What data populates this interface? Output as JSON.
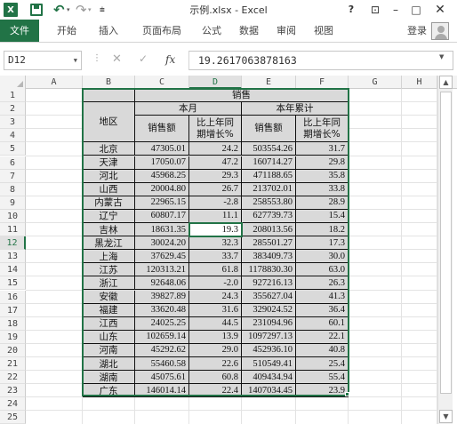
{
  "app": {
    "title": "示例.xlsx - Excel",
    "excel_logo": "X",
    "accent_color": "#217346",
    "icons": [
      "excel-logo-icon",
      "save-icon",
      "undo-icon",
      "redo-icon",
      "help-icon",
      "ribbon-options-icon",
      "minimize-icon",
      "maximize-icon",
      "close-icon",
      "avatar"
    ],
    "help": "?",
    "minimize": "–",
    "maximize": "□",
    "close": "✕"
  },
  "ribbon": {
    "tabs": [
      "文件",
      "开始",
      "插入",
      "页面布局",
      "公式",
      "数据",
      "审阅",
      "视图"
    ],
    "login": "登录"
  },
  "formula_bar": {
    "name_box": "D12",
    "fx": "fx",
    "formula": "19.2617063878163"
  },
  "grid": {
    "columns": [
      "A",
      "B",
      "C",
      "D",
      "E",
      "F",
      "G",
      "H"
    ],
    "selected_column": "D",
    "rows": [
      "1",
      "2",
      "3",
      "4",
      "5",
      "6",
      "7",
      "8",
      "9",
      "10",
      "11",
      "12",
      "13",
      "14",
      "15",
      "16",
      "17",
      "18",
      "19",
      "20",
      "21",
      "22",
      "23",
      "24",
      "25"
    ],
    "selected_row": "12",
    "active_cell": "D12"
  },
  "table": {
    "header_top": "销售",
    "header_region": "地区",
    "header_month": "本月",
    "header_ytd": "本年累计",
    "header_sales": "销售额",
    "header_yoy_line1": "比上年同",
    "header_yoy_line2": "期增长%",
    "header_sales2": "销售额",
    "header_yoy2_line1": "比上年同",
    "header_yoy2_line2": "期增长%",
    "rows": [
      {
        "region": "北京",
        "sales": "47305.01",
        "yoy": "24.2",
        "ytd_sales": "503554.26",
        "ytd_yoy": "31.7"
      },
      {
        "region": "天津",
        "sales": "17050.07",
        "yoy": "47.2",
        "ytd_sales": "160714.27",
        "ytd_yoy": "29.8"
      },
      {
        "region": "河北",
        "sales": "45968.25",
        "yoy": "29.3",
        "ytd_sales": "471188.65",
        "ytd_yoy": "35.8"
      },
      {
        "region": "山西",
        "sales": "20004.80",
        "yoy": "26.7",
        "ytd_sales": "213702.01",
        "ytd_yoy": "33.8"
      },
      {
        "region": "内蒙古",
        "sales": "22965.15",
        "yoy": "-2.8",
        "ytd_sales": "258553.80",
        "ytd_yoy": "28.9"
      },
      {
        "region": "辽宁",
        "sales": "60807.17",
        "yoy": "11.1",
        "ytd_sales": "627739.73",
        "ytd_yoy": "15.4"
      },
      {
        "region": "吉林",
        "sales": "18631.35",
        "yoy": "19.3",
        "ytd_sales": "208013.56",
        "ytd_yoy": "18.2"
      },
      {
        "region": "黑龙江",
        "sales": "30024.20",
        "yoy": "32.3",
        "ytd_sales": "285501.27",
        "ytd_yoy": "17.3"
      },
      {
        "region": "上海",
        "sales": "37629.45",
        "yoy": "33.7",
        "ytd_sales": "383409.73",
        "ytd_yoy": "30.0"
      },
      {
        "region": "江苏",
        "sales": "120313.21",
        "yoy": "61.8",
        "ytd_sales": "1178830.30",
        "ytd_yoy": "63.0"
      },
      {
        "region": "浙江",
        "sales": "92648.06",
        "yoy": "-2.0",
        "ytd_sales": "927216.13",
        "ytd_yoy": "26.3"
      },
      {
        "region": "安徽",
        "sales": "39827.89",
        "yoy": "24.3",
        "ytd_sales": "355627.04",
        "ytd_yoy": "41.3"
      },
      {
        "region": "福建",
        "sales": "33620.48",
        "yoy": "31.6",
        "ytd_sales": "329024.52",
        "ytd_yoy": "36.4"
      },
      {
        "region": "江西",
        "sales": "24025.25",
        "yoy": "44.5",
        "ytd_sales": "231094.96",
        "ytd_yoy": "60.1"
      },
      {
        "region": "山东",
        "sales": "102659.14",
        "yoy": "13.9",
        "ytd_sales": "1097297.13",
        "ytd_yoy": "22.1"
      },
      {
        "region": "河南",
        "sales": "45292.62",
        "yoy": "29.0",
        "ytd_sales": "452936.10",
        "ytd_yoy": "40.8"
      },
      {
        "region": "湖北",
        "sales": "55460.58",
        "yoy": "22.6",
        "ytd_sales": "510549.41",
        "ytd_yoy": "25.4"
      },
      {
        "region": "湖南",
        "sales": "45075.61",
        "yoy": "60.8",
        "ytd_sales": "409434.94",
        "ytd_yoy": "55.4"
      },
      {
        "region": "广东",
        "sales": "146014.14",
        "yoy": "22.4",
        "ytd_sales": "1407034.45",
        "ytd_yoy": "23.9"
      }
    ]
  }
}
